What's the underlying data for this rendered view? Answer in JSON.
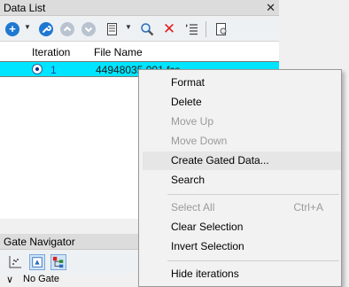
{
  "data_list": {
    "title": "Data List",
    "close_glyph": "✕",
    "toolbar": {
      "icons": [
        "add-icon",
        "wrench-icon",
        "move-up-icon",
        "move-down-icon",
        "columns-icon",
        "search-icon",
        "delete-icon",
        "list-icon",
        "report-icon"
      ],
      "add_glyph": "+",
      "delete_glyph": "✕",
      "caret": "▼"
    },
    "columns": [
      "Iteration",
      "File Name"
    ],
    "rows": [
      {
        "iteration": "1",
        "file_name": "44948035.001.fcs"
      }
    ]
  },
  "gate_navigator": {
    "title": "Gate Navigator",
    "tree_expander": "∨",
    "root": "No Gate"
  },
  "context_menu": {
    "items": [
      {
        "label": "Format",
        "shortcut": "",
        "enabled": true
      },
      {
        "label": "Delete",
        "shortcut": "",
        "enabled": true
      },
      {
        "label": "Move Up",
        "shortcut": "",
        "enabled": false
      },
      {
        "label": "Move Down",
        "shortcut": "",
        "enabled": false
      },
      {
        "label": "Create Gated Data...",
        "shortcut": "",
        "enabled": true,
        "highlighted": true
      },
      {
        "label": "Search",
        "shortcut": "",
        "enabled": true
      },
      {
        "label": "Select All",
        "shortcut": "Ctrl+A",
        "enabled": false
      },
      {
        "label": "Clear Selection",
        "shortcut": "",
        "enabled": true
      },
      {
        "label": "Invert Selection",
        "shortcut": "",
        "enabled": true
      },
      {
        "label": "Hide iterations",
        "shortcut": "",
        "enabled": true
      }
    ]
  },
  "colors": {
    "selection": "#00e5ff",
    "toolbar_blue": "#1f78d1",
    "delete_red": "#e02020",
    "menu_bg": "#f2f2f2"
  }
}
